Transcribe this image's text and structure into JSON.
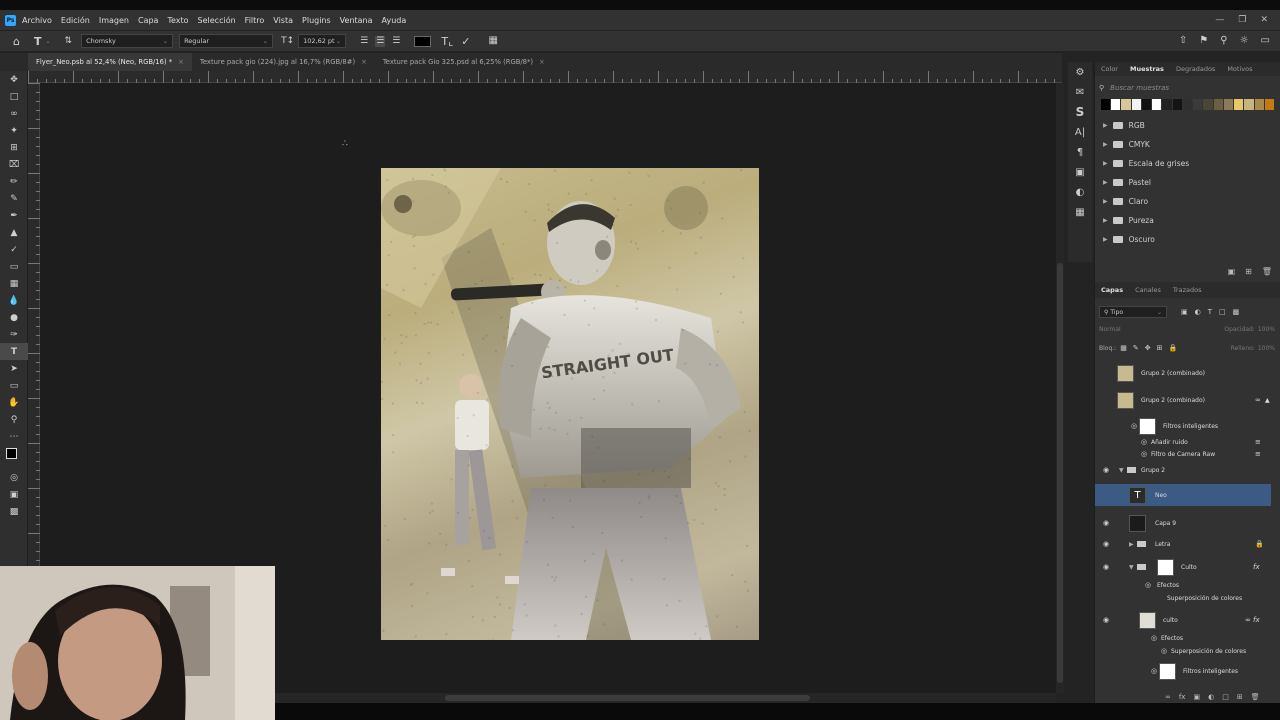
{
  "app": {
    "logo": "Ps"
  },
  "menu": [
    "Archivo",
    "Edición",
    "Imagen",
    "Capa",
    "Texto",
    "Selección",
    "Filtro",
    "Vista",
    "Plugins",
    "Ventana",
    "Ayuda"
  ],
  "options": {
    "font_family": "Chomsky",
    "font_style": "Regular",
    "font_size": "102,62 pt"
  },
  "tabs": [
    {
      "label": "Flyer_Neo.psb al 52,4% (Neo, RGB/16) *",
      "active": true
    },
    {
      "label": "Texture pack gio (224).jpg al 16,7% (RGB/8#)",
      "active": false
    },
    {
      "label": "Texture pack Gio 325.psd al 6,25% (RGB/8*)",
      "active": false
    }
  ],
  "swatches_panel": {
    "tabs": [
      "Color",
      "Muestras",
      "Degradados",
      "Motivos"
    ],
    "active_tab": "Muestras",
    "search_placeholder": "Buscar muestras",
    "swatch_colors": [
      "#000000",
      "#ffffff",
      "#d6c89a",
      "#f2f2f2",
      "#111111",
      "#ffffff",
      "#222222",
      "#141414",
      "#303030",
      "#3a3a3a",
      "#4a4536",
      "#6a5f45",
      "#8c7b56",
      "#e8c86a",
      "#c9b480",
      "#a88a4a",
      "#c47a14"
    ],
    "groups": [
      "RGB",
      "CMYK",
      "Escala de grises",
      "Pastel",
      "Claro",
      "Pureza",
      "Oscuro"
    ]
  },
  "layers_panel": {
    "tabs": [
      "Capas",
      "Canales",
      "Trazados"
    ],
    "active_tab": "Capas",
    "filter_kind": "Tipo",
    "blend_mode": "Normal",
    "opacity_label": "Opacidad:",
    "opacity_value": "100%",
    "lock_label": "Bloq.:",
    "fill_label": "Relleno:",
    "fill_value": "100%",
    "layers": [
      {
        "name": "Grupo 2 (combinado)",
        "visible": false
      },
      {
        "name": "Grupo 2 (combinado)",
        "visible": false
      },
      {
        "name": "Filtros inteligentes",
        "visible": false
      },
      {
        "name": "Añadir ruido",
        "visible": true
      },
      {
        "name": "Filtro de Camera Raw",
        "visible": true
      },
      {
        "name": "Grupo 2",
        "visible": true
      },
      {
        "name": "Neo",
        "visible": false,
        "selected": true
      },
      {
        "name": "Capa 9",
        "visible": true
      },
      {
        "name": "Letra",
        "visible": true
      },
      {
        "name": "Culto",
        "visible": true
      },
      {
        "name": "Efectos",
        "visible": true
      },
      {
        "name": "Superposición de colores",
        "visible": true
      },
      {
        "name": "culto",
        "visible": true
      },
      {
        "name": "Efectos",
        "visible": true
      },
      {
        "name": "Superposición de colores",
        "visible": true
      },
      {
        "name": "Filtros inteligentes",
        "visible": true
      }
    ]
  },
  "colors": {
    "accent": "#31a8ff",
    "selection": "#3b5a84"
  }
}
